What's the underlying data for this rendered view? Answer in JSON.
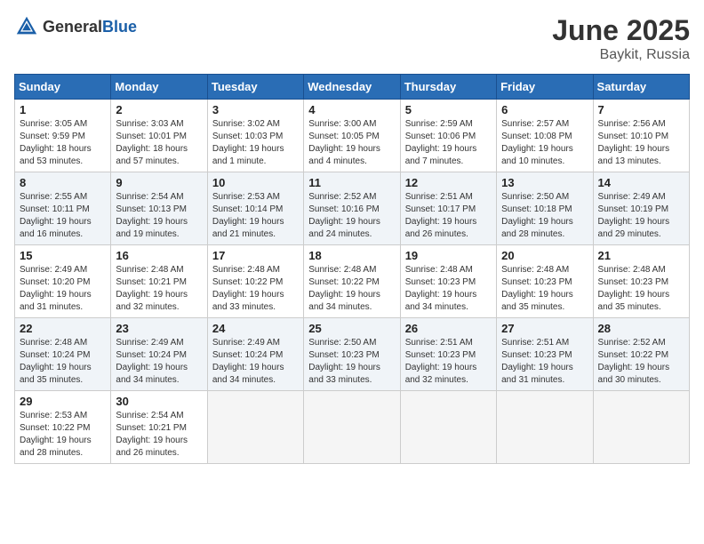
{
  "header": {
    "logo_general": "General",
    "logo_blue": "Blue",
    "title": "June 2025",
    "location": "Baykit, Russia"
  },
  "calendar": {
    "days_of_week": [
      "Sunday",
      "Monday",
      "Tuesday",
      "Wednesday",
      "Thursday",
      "Friday",
      "Saturday"
    ],
    "weeks": [
      [
        {
          "day": "1",
          "sunrise": "3:05 AM",
          "sunset": "9:59 PM",
          "daylight": "18 hours and 53 minutes."
        },
        {
          "day": "2",
          "sunrise": "3:03 AM",
          "sunset": "10:01 PM",
          "daylight": "18 hours and 57 minutes."
        },
        {
          "day": "3",
          "sunrise": "3:02 AM",
          "sunset": "10:03 PM",
          "daylight": "19 hours and 1 minute."
        },
        {
          "day": "4",
          "sunrise": "3:00 AM",
          "sunset": "10:05 PM",
          "daylight": "19 hours and 4 minutes."
        },
        {
          "day": "5",
          "sunrise": "2:59 AM",
          "sunset": "10:06 PM",
          "daylight": "19 hours and 7 minutes."
        },
        {
          "day": "6",
          "sunrise": "2:57 AM",
          "sunset": "10:08 PM",
          "daylight": "19 hours and 10 minutes."
        },
        {
          "day": "7",
          "sunrise": "2:56 AM",
          "sunset": "10:10 PM",
          "daylight": "19 hours and 13 minutes."
        }
      ],
      [
        {
          "day": "8",
          "sunrise": "2:55 AM",
          "sunset": "10:11 PM",
          "daylight": "19 hours and 16 minutes."
        },
        {
          "day": "9",
          "sunrise": "2:54 AM",
          "sunset": "10:13 PM",
          "daylight": "19 hours and 19 minutes."
        },
        {
          "day": "10",
          "sunrise": "2:53 AM",
          "sunset": "10:14 PM",
          "daylight": "19 hours and 21 minutes."
        },
        {
          "day": "11",
          "sunrise": "2:52 AM",
          "sunset": "10:16 PM",
          "daylight": "19 hours and 24 minutes."
        },
        {
          "day": "12",
          "sunrise": "2:51 AM",
          "sunset": "10:17 PM",
          "daylight": "19 hours and 26 minutes."
        },
        {
          "day": "13",
          "sunrise": "2:50 AM",
          "sunset": "10:18 PM",
          "daylight": "19 hours and 28 minutes."
        },
        {
          "day": "14",
          "sunrise": "2:49 AM",
          "sunset": "10:19 PM",
          "daylight": "19 hours and 29 minutes."
        }
      ],
      [
        {
          "day": "15",
          "sunrise": "2:49 AM",
          "sunset": "10:20 PM",
          "daylight": "19 hours and 31 minutes."
        },
        {
          "day": "16",
          "sunrise": "2:48 AM",
          "sunset": "10:21 PM",
          "daylight": "19 hours and 32 minutes."
        },
        {
          "day": "17",
          "sunrise": "2:48 AM",
          "sunset": "10:22 PM",
          "daylight": "19 hours and 33 minutes."
        },
        {
          "day": "18",
          "sunrise": "2:48 AM",
          "sunset": "10:22 PM",
          "daylight": "19 hours and 34 minutes."
        },
        {
          "day": "19",
          "sunrise": "2:48 AM",
          "sunset": "10:23 PM",
          "daylight": "19 hours and 34 minutes."
        },
        {
          "day": "20",
          "sunrise": "2:48 AM",
          "sunset": "10:23 PM",
          "daylight": "19 hours and 35 minutes."
        },
        {
          "day": "21",
          "sunrise": "2:48 AM",
          "sunset": "10:23 PM",
          "daylight": "19 hours and 35 minutes."
        }
      ],
      [
        {
          "day": "22",
          "sunrise": "2:48 AM",
          "sunset": "10:24 PM",
          "daylight": "19 hours and 35 minutes."
        },
        {
          "day": "23",
          "sunrise": "2:49 AM",
          "sunset": "10:24 PM",
          "daylight": "19 hours and 34 minutes."
        },
        {
          "day": "24",
          "sunrise": "2:49 AM",
          "sunset": "10:24 PM",
          "daylight": "19 hours and 34 minutes."
        },
        {
          "day": "25",
          "sunrise": "2:50 AM",
          "sunset": "10:23 PM",
          "daylight": "19 hours and 33 minutes."
        },
        {
          "day": "26",
          "sunrise": "2:51 AM",
          "sunset": "10:23 PM",
          "daylight": "19 hours and 32 minutes."
        },
        {
          "day": "27",
          "sunrise": "2:51 AM",
          "sunset": "10:23 PM",
          "daylight": "19 hours and 31 minutes."
        },
        {
          "day": "28",
          "sunrise": "2:52 AM",
          "sunset": "10:22 PM",
          "daylight": "19 hours and 30 minutes."
        }
      ],
      [
        {
          "day": "29",
          "sunrise": "2:53 AM",
          "sunset": "10:22 PM",
          "daylight": "19 hours and 28 minutes."
        },
        {
          "day": "30",
          "sunrise": "2:54 AM",
          "sunset": "10:21 PM",
          "daylight": "19 hours and 26 minutes."
        },
        null,
        null,
        null,
        null,
        null
      ]
    ]
  }
}
